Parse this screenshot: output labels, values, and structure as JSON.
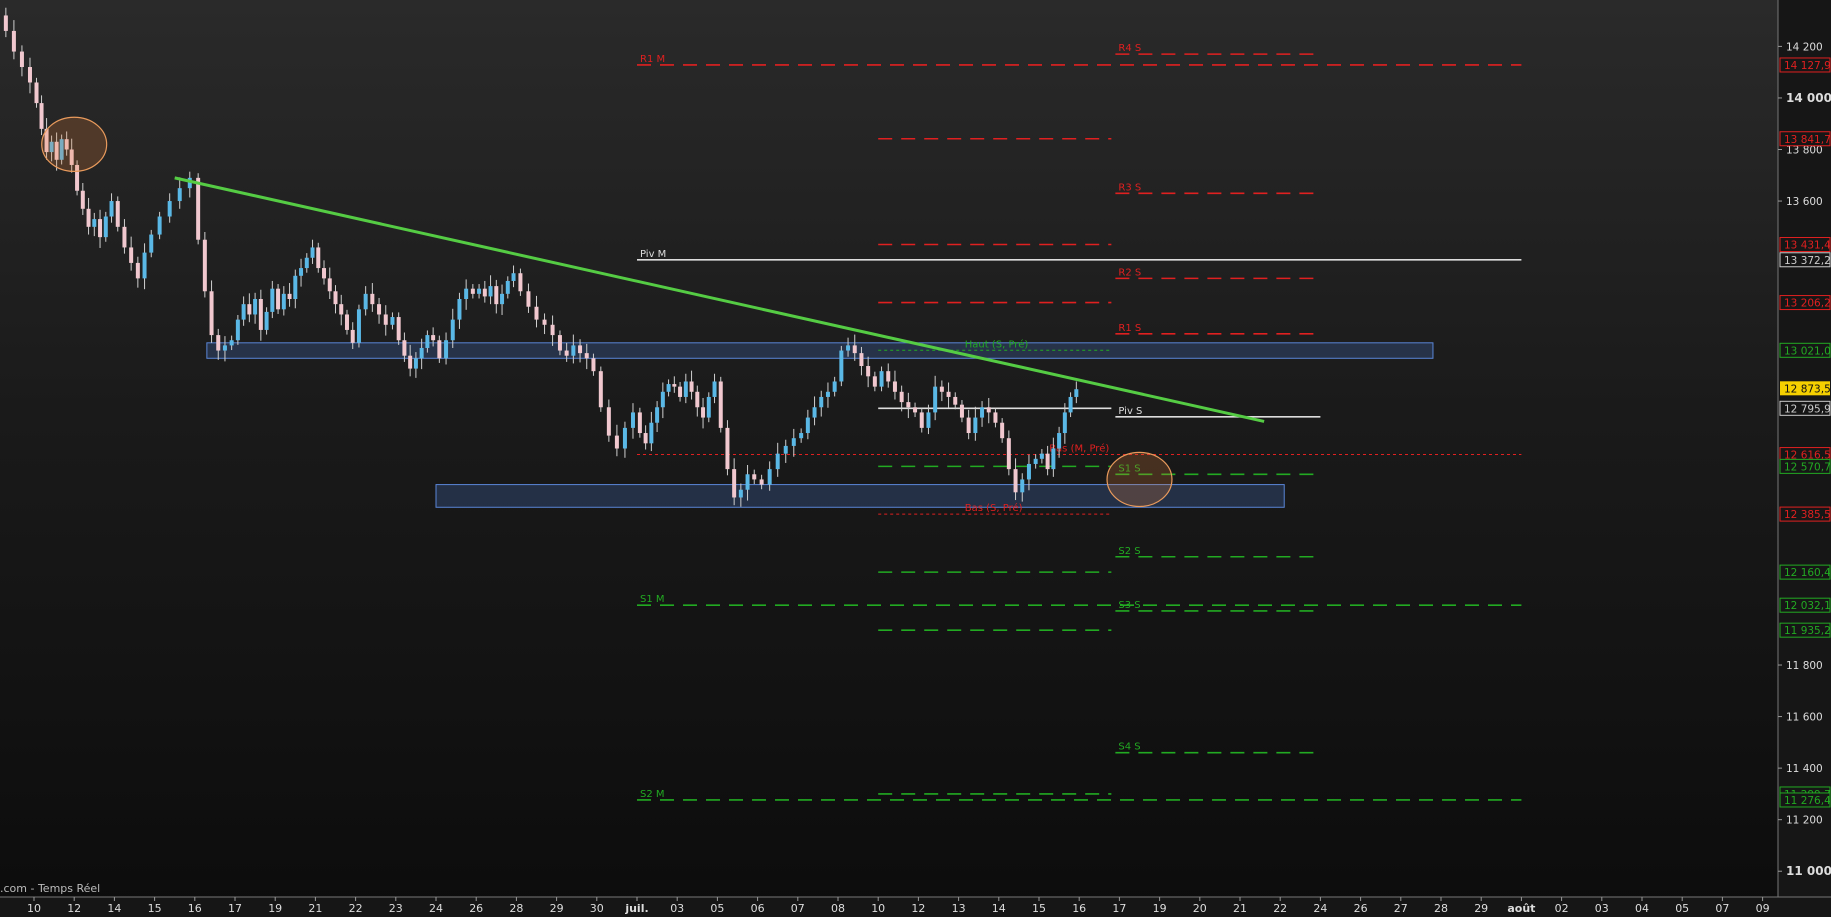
{
  "watermark": ".com - Temps Réel",
  "chart_data": {
    "type": "candlestick",
    "ylim": [
      10900,
      14380
    ],
    "y_ticks": [
      {
        "value": 14200,
        "label": "14 200"
      },
      {
        "value": 14000,
        "label": "14 000",
        "bold": true
      },
      {
        "value": 13800,
        "label": "13 800"
      },
      {
        "value": 13600,
        "label": "13 600"
      },
      {
        "value": 11800,
        "label": "11 800"
      },
      {
        "value": 11600,
        "label": "11 600"
      },
      {
        "value": 11400,
        "label": "11 400"
      },
      {
        "value": 11200,
        "label": "11 200"
      },
      {
        "value": 11000,
        "label": "11 000",
        "bold": true
      }
    ],
    "x_ticks": [
      {
        "i": 0,
        "label": "10"
      },
      {
        "i": 1,
        "label": "12"
      },
      {
        "i": 2,
        "label": "14"
      },
      {
        "i": 3,
        "label": "15"
      },
      {
        "i": 4,
        "label": "16"
      },
      {
        "i": 5,
        "label": "17"
      },
      {
        "i": 6,
        "label": "19"
      },
      {
        "i": 7,
        "label": "21"
      },
      {
        "i": 8,
        "label": "22"
      },
      {
        "i": 9,
        "label": "23"
      },
      {
        "i": 10,
        "label": "24"
      },
      {
        "i": 11,
        "label": "26"
      },
      {
        "i": 12,
        "label": "28"
      },
      {
        "i": 13,
        "label": "29"
      },
      {
        "i": 14,
        "label": "30"
      },
      {
        "i": 15,
        "label": "juil.",
        "bold": true
      },
      {
        "i": 16,
        "label": "03"
      },
      {
        "i": 17,
        "label": "05"
      },
      {
        "i": 18,
        "label": "06"
      },
      {
        "i": 19,
        "label": "07"
      },
      {
        "i": 20,
        "label": "08"
      },
      {
        "i": 21,
        "label": "10"
      },
      {
        "i": 22,
        "label": "12"
      },
      {
        "i": 23,
        "label": "13"
      },
      {
        "i": 24,
        "label": "14"
      },
      {
        "i": 25,
        "label": "15"
      },
      {
        "i": 26,
        "label": "16"
      },
      {
        "i": 27,
        "label": "17"
      },
      {
        "i": 28,
        "label": "19"
      },
      {
        "i": 29,
        "label": "20"
      },
      {
        "i": 30,
        "label": "21"
      },
      {
        "i": 31,
        "label": "22"
      },
      {
        "i": 32,
        "label": "24"
      },
      {
        "i": 33,
        "label": "26"
      },
      {
        "i": 34,
        "label": "27"
      },
      {
        "i": 35,
        "label": "28"
      },
      {
        "i": 36,
        "label": "29"
      },
      {
        "i": 37,
        "label": "août",
        "bold": true
      },
      {
        "i": 38,
        "label": "02"
      },
      {
        "i": 39,
        "label": "03"
      },
      {
        "i": 40,
        "label": "04"
      },
      {
        "i": 41,
        "label": "05"
      },
      {
        "i": 42,
        "label": "07"
      },
      {
        "i": 43,
        "label": "09"
      }
    ],
    "price_badges": [
      {
        "value": 14127.9,
        "label": "14 127,9",
        "color": "#e02020"
      },
      {
        "value": 13841.7,
        "label": "13 841,7",
        "color": "#e02020"
      },
      {
        "value": 13431.4,
        "label": "13 431,4",
        "color": "#e02020"
      },
      {
        "value": 13372.2,
        "label": "13 372,2",
        "color": "#cccccc"
      },
      {
        "value": 13206.2,
        "label": "13 206,2",
        "color": "#e02020"
      },
      {
        "value": 13021.0,
        "label": "13 021,0",
        "color": "#22aa22"
      },
      {
        "value": 12873.5,
        "label": "12 873,5",
        "color": "#f5d000",
        "current": true
      },
      {
        "value": 12795.9,
        "label": "12 795,9",
        "color": "#cccccc"
      },
      {
        "value": 12616.5,
        "label": "12 616,5",
        "color": "#e02020"
      },
      {
        "value": 12570.7,
        "label": "12 570,7",
        "color": "#22aa22"
      },
      {
        "value": 12385.5,
        "label": "12 385,5",
        "color": "#e02020"
      },
      {
        "value": 12160.4,
        "label": "12 160,4",
        "color": "#22aa22"
      },
      {
        "value": 12032.1,
        "label": "12 032,1",
        "color": "#22aa22"
      },
      {
        "value": 11935.2,
        "label": "11 935,2",
        "color": "#22aa22"
      },
      {
        "value": 11299.7,
        "label": "11 299,7",
        "color": "#22aa22"
      },
      {
        "value": 11276.4,
        "label": "11 276,4",
        "color": "#22aa22"
      }
    ],
    "pivot_lines": [
      {
        "label": "R1 M",
        "value": 14127.9,
        "x0": 15.0,
        "x1": 37.0,
        "color": "#e02020",
        "dash": true
      },
      {
        "label": "Piv M",
        "value": 13372.2,
        "x0": 15.0,
        "x1": 37.0,
        "color": "#dddddd",
        "dash": false
      },
      {
        "label": "S1 M",
        "value": 12032.1,
        "x0": 15.0,
        "x1": 37.0,
        "color": "#22aa22",
        "dash": true
      },
      {
        "label": "S2 M",
        "value": 11276.4,
        "x0": 15.0,
        "x1": 37.0,
        "color": "#22aa22",
        "dash": true
      },
      {
        "label": "R4 S",
        "value": 14170,
        "x0": 26.9,
        "x1": 32.0,
        "color": "#e02020",
        "dash": true
      },
      {
        "label": "R3 S",
        "value": 13630,
        "x0": 26.9,
        "x1": 32.0,
        "color": "#e02020",
        "dash": true
      },
      {
        "label": "R2 S",
        "value": 13300,
        "x0": 26.9,
        "x1": 32.0,
        "color": "#e02020",
        "dash": true
      },
      {
        "label": "R1 S",
        "value": 13085,
        "x0": 26.9,
        "x1": 32.0,
        "color": "#e02020",
        "dash": true
      },
      {
        "label": "Piv S",
        "value": 12763,
        "x0": 26.9,
        "x1": 32.0,
        "color": "#dddddd",
        "dash": false
      },
      {
        "label": "S1 S",
        "value": 12540,
        "x0": 26.9,
        "x1": 32.0,
        "color": "#22aa22",
        "dash": true
      },
      {
        "label": "S2 S",
        "value": 12220,
        "x0": 26.9,
        "x1": 32.0,
        "color": "#22aa22",
        "dash": true
      },
      {
        "label": "S3 S",
        "value": 12010,
        "x0": 26.9,
        "x1": 32.0,
        "color": "#22aa22",
        "dash": true
      },
      {
        "label": "S4 S",
        "value": 11460,
        "x0": 26.9,
        "x1": 32.0,
        "color": "#22aa22",
        "dash": true
      },
      {
        "label": "",
        "value": 13841.7,
        "x0": 21.0,
        "x1": 26.8,
        "color": "#e02020",
        "dash": true
      },
      {
        "label": "",
        "value": 13431.4,
        "x0": 21.0,
        "x1": 26.8,
        "color": "#e02020",
        "dash": true
      },
      {
        "label": "",
        "value": 13206.2,
        "x0": 21.0,
        "x1": 26.8,
        "color": "#e02020",
        "dash": true
      },
      {
        "label": "Haut (S, Pré)",
        "value": 13021.0,
        "x0": 21.0,
        "x1": 26.8,
        "color": "#22aa22",
        "dash": true,
        "fine": true
      },
      {
        "label": "",
        "value": 12795.9,
        "x0": 21.0,
        "x1": 26.8,
        "color": "#dddddd",
        "dash": false
      },
      {
        "label": "",
        "value": 12570.7,
        "x0": 21.0,
        "x1": 26.8,
        "color": "#22aa22",
        "dash": true
      },
      {
        "label": "Bas (S, Pré)",
        "value": 12385.5,
        "x0": 21.0,
        "x1": 26.8,
        "color": "#e02020",
        "dash": true,
        "fine": true
      },
      {
        "label": "",
        "value": 12160.4,
        "x0": 21.0,
        "x1": 26.8,
        "color": "#22aa22",
        "dash": true
      },
      {
        "label": "",
        "value": 11935.2,
        "x0": 21.0,
        "x1": 26.8,
        "color": "#22aa22",
        "dash": true
      },
      {
        "label": "",
        "value": 11299.7,
        "x0": 21.0,
        "x1": 26.8,
        "color": "#22aa22",
        "dash": true
      },
      {
        "label": "Bas (M, Pré)",
        "value": 12616.5,
        "x0": 15.0,
        "x1": 37.0,
        "color": "#e02020",
        "dash": true,
        "fine": true
      }
    ],
    "zones": [
      {
        "name": "resistance-zone",
        "x0": 4.3,
        "x1": 34.8,
        "y_high": 13050,
        "y_low": 12990
      },
      {
        "name": "support-zone",
        "x0": 10.0,
        "x1": 31.1,
        "y_high": 12500,
        "y_low": 12412
      }
    ],
    "trendline": {
      "x0": 3.5,
      "y0": 13690,
      "x1": 30.6,
      "y1": 12745,
      "color": "#55cc44"
    },
    "ellipses": [
      {
        "cx": 1.0,
        "cy": 13820,
        "rx": 0.95,
        "ry": 105
      },
      {
        "cx": 27.5,
        "cy": 12520,
        "rx": 0.95,
        "ry": 105
      }
    ],
    "candle_segments": [
      {
        "i0": -1.0,
        "i1": 0.0,
        "prices": [
          14380,
          14320,
          14260,
          14180,
          14120,
          14060
        ]
      },
      {
        "i0": 0.0,
        "i1": 1.0,
        "prices": [
          14060,
          13980,
          13880,
          13790,
          13830,
          13760,
          13840,
          13800,
          13740
        ]
      },
      {
        "i0": 1.0,
        "i1": 2.0,
        "prices": [
          13740,
          13640,
          13570,
          13500,
          13530,
          13460,
          13540,
          13600
        ]
      },
      {
        "i0": 2.0,
        "i1": 3.0,
        "prices": [
          13600,
          13500,
          13420,
          13360,
          13300,
          13400,
          13470
        ]
      },
      {
        "i0": 3.0,
        "i1": 4.0,
        "prices": [
          13470,
          13540,
          13600,
          13650,
          13690
        ]
      },
      {
        "i0": 4.0,
        "i1": 5.0,
        "prices": [
          13690,
          13450,
          13250,
          13080,
          13020,
          13040,
          13060
        ]
      },
      {
        "i0": 5.0,
        "i1": 6.0,
        "prices": [
          13060,
          13140,
          13200,
          13160,
          13220,
          13100,
          13170,
          13260
        ]
      },
      {
        "i0": 6.0,
        "i1": 7.0,
        "prices": [
          13260,
          13180,
          13240,
          13220,
          13310,
          13340,
          13380,
          13420
        ]
      },
      {
        "i0": 7.0,
        "i1": 8.0,
        "prices": [
          13420,
          13340,
          13300,
          13250,
          13200,
          13160,
          13100,
          13050
        ]
      },
      {
        "i0": 8.0,
        "i1": 9.0,
        "prices": [
          13050,
          13180,
          13240,
          13200,
          13160,
          13120,
          13150
        ]
      },
      {
        "i0": 9.0,
        "i1": 10.0,
        "prices": [
          13150,
          13060,
          13000,
          12950,
          12990,
          13030,
          13080,
          13060
        ]
      },
      {
        "i0": 10.0,
        "i1": 11.0,
        "prices": [
          13060,
          12990,
          13060,
          13140,
          13220,
          13260,
          13240
        ]
      },
      {
        "i0": 11.0,
        "i1": 12.0,
        "prices": [
          13240,
          13260,
          13230,
          13270,
          13200,
          13240,
          13290,
          13320
        ]
      },
      {
        "i0": 12.0,
        "i1": 13.0,
        "prices": [
          13320,
          13250,
          13190,
          13140,
          13120,
          13080
        ]
      },
      {
        "i0": 13.0,
        "i1": 14.0,
        "prices": [
          13080,
          13020,
          13000,
          13040,
          13010,
          12990,
          12940
        ]
      },
      {
        "i0": 14.0,
        "i1": 15.0,
        "prices": [
          12940,
          12800,
          12690,
          12640,
          12720,
          12780
        ]
      },
      {
        "i0": 15.0,
        "i1": 16.0,
        "prices": [
          12780,
          12700,
          12660,
          12740,
          12800,
          12860,
          12890,
          12880
        ]
      },
      {
        "i0": 16.0,
        "i1": 17.0,
        "prices": [
          12880,
          12840,
          12900,
          12860,
          12800,
          12760,
          12840,
          12900
        ]
      },
      {
        "i0": 17.0,
        "i1": 18.0,
        "prices": [
          12900,
          12720,
          12560,
          12450,
          12480,
          12540,
          12520
        ]
      },
      {
        "i0": 18.0,
        "i1": 19.0,
        "prices": [
          12520,
          12500,
          12560,
          12620,
          12650,
          12680
        ]
      },
      {
        "i0": 19.0,
        "i1": 20.0,
        "prices": [
          12680,
          12700,
          12760,
          12800,
          12840,
          12860,
          12900
        ]
      },
      {
        "i0": 20.0,
        "i1": 21.0,
        "prices": [
          12900,
          13020,
          13040,
          13010,
          12960,
          12920,
          12880
        ]
      },
      {
        "i0": 21.0,
        "i1": 22.0,
        "prices": [
          12880,
          12940,
          12900,
          12860,
          12820,
          12800,
          12780
        ]
      },
      {
        "i0": 22.0,
        "i1": 23.0,
        "prices": [
          12780,
          12720,
          12780,
          12880,
          12860,
          12840,
          12810
        ]
      },
      {
        "i0": 23.0,
        "i1": 24.0,
        "prices": [
          12810,
          12760,
          12700,
          12760,
          12800,
          12780,
          12740
        ]
      },
      {
        "i0": 24.0,
        "i1": 25.0,
        "prices": [
          12740,
          12680,
          12560,
          12470,
          12520,
          12580,
          12600
        ]
      },
      {
        "i0": 25.0,
        "i1": 26.0,
        "prices": [
          12600,
          12620,
          12560,
          12640,
          12700,
          12780,
          12840,
          12870
        ]
      }
    ],
    "badge_colors": {
      "up": "#5ab8e6",
      "down": "#f1c8cf"
    }
  }
}
